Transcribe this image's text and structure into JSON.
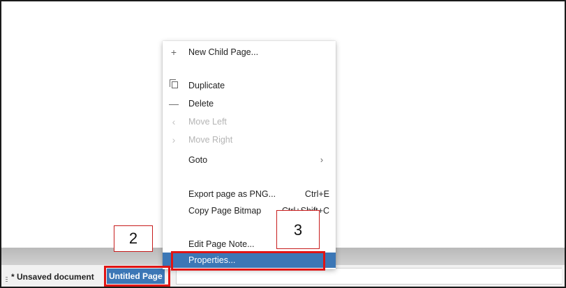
{
  "context_menu": {
    "items": [
      {
        "icon": "+",
        "label": "New Child Page...",
        "shortcut": "",
        "enabled": true
      },
      {
        "icon": "",
        "label": "Duplicate",
        "shortcut": "",
        "enabled": true
      },
      {
        "icon": "—",
        "label": "Delete",
        "shortcut": "",
        "enabled": true
      },
      {
        "icon": "‹",
        "label": "Move Left",
        "shortcut": "",
        "enabled": false
      },
      {
        "icon": "›",
        "label": "Move Right",
        "shortcut": "",
        "enabled": false
      },
      {
        "icon": "",
        "label": "Goto",
        "shortcut": "",
        "enabled": true,
        "submenu_arrow": "›"
      },
      {
        "icon": "",
        "label": "Export page as PNG...",
        "shortcut": "Ctrl+E",
        "enabled": true
      },
      {
        "icon": "",
        "label": "Copy Page Bitmap",
        "shortcut": "Ctrl+Shift+C",
        "enabled": true
      },
      {
        "icon": "",
        "label": "Edit Page Note...",
        "shortcut": "",
        "enabled": true
      },
      {
        "icon": "",
        "label": "Properties...",
        "shortcut": "",
        "enabled": true,
        "selected": true
      }
    ]
  },
  "tabs": {
    "document": "* Unsaved document",
    "active_page": "Untitled Page"
  },
  "annotations": {
    "step_2": "2",
    "step_3": "3",
    "highlight_color": "#e01414"
  },
  "colors": {
    "selection": "#3c77b6"
  }
}
